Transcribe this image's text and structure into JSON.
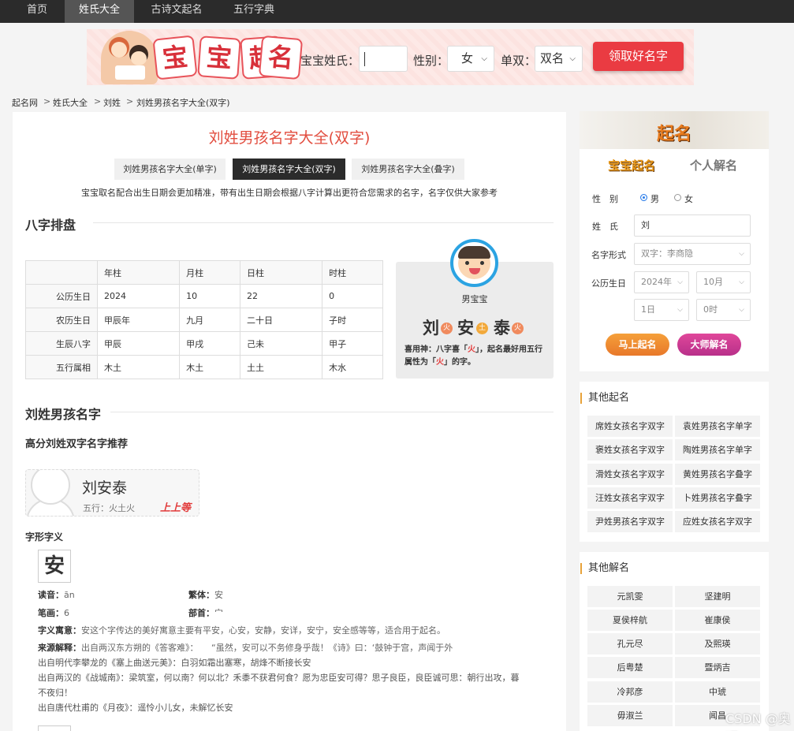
{
  "nav": [
    "首页",
    "姓氏大全",
    "古诗文起名",
    "五行字典"
  ],
  "banner": {
    "title_chars": [
      "宝",
      "宝",
      "起",
      "名"
    ],
    "surname_label": "宝宝姓氏：",
    "gender_label": "性别：",
    "gender_value": "女",
    "single_double_label": "单双：",
    "single_double_value": "双名",
    "button": "领取好名字"
  },
  "breadcrumb": [
    "起名网",
    "姓氏大全",
    "刘姓",
    "刘姓男孩名字大全(双字)"
  ],
  "breadcrumb_sep": ">",
  "page_title": "刘姓男孩名字大全(双字)",
  "tabs": [
    "刘姓男孩名字大全(单字)",
    "刘姓男孩名字大全(双字)",
    "刘姓男孩名字大全(叠字)"
  ],
  "note": "宝宝取名配合出生日期会更加精准，带有出生日期会根据八字计算出更符合您需求的名字，名字仅供大家参考",
  "bazi": {
    "heading": "八字排盘",
    "columns": [
      "年柱",
      "月柱",
      "日柱",
      "时柱"
    ],
    "rows": [
      {
        "label": "公历生日",
        "cells": [
          "2024",
          "10",
          "22",
          "0"
        ]
      },
      {
        "label": "农历生日",
        "cells": [
          "甲辰年",
          "九月",
          "二十日",
          "子时"
        ]
      },
      {
        "label": "生辰八字",
        "cells": [
          "甲辰",
          "甲戌",
          "己未",
          "甲子"
        ]
      },
      {
        "label": "五行属相",
        "cells": [
          "木土",
          "木土",
          "土土",
          "木水"
        ]
      }
    ]
  },
  "baby": {
    "label": "男宝宝",
    "chars": [
      {
        "c": "刘",
        "wx": "火"
      },
      {
        "c": "安",
        "wx": "土"
      },
      {
        "c": "泰",
        "wx": "火"
      }
    ],
    "xiyong_a": "喜用神：八字喜「",
    "xiyong_b": "火",
    "xiyong_c": "」，起名最好用五行属性为「",
    "xiyong_d": "火",
    "xiyong_e": "」的字。"
  },
  "names_heading": "刘姓男孩名字",
  "recommend_heading": "高分刘姓双字名字推荐",
  "name_card": {
    "name": "刘安泰",
    "wuxing": "五行：火土火",
    "grade": "上上等"
  },
  "zixing": {
    "heading": "字形字义",
    "char": "安",
    "duyin_k": "读音：",
    "duyin_v": "ān",
    "fanti_k": "繁体：",
    "fanti_v": "安",
    "bihua_k": "笔画：",
    "bihua_v": "6",
    "bushou_k": "部首：",
    "bushou_v": "宀",
    "yuyi_k": "字义寓意：",
    "yuyi_v": "安这个字传达的美好寓意主要有平安，心安，安静，安详，安宁，安全感等等，适合用于起名。",
    "laiyuan_k": "来源解释：",
    "laiyuan_1": "出自两汉东方朔的《答客难》：　　“虽然，安可以不务修身乎哉！《诗》曰：‘鼓钟于宫，声闻于外",
    "laiyuan_2": "出自明代李攀龙的《塞上曲送元美》：白羽如霜出塞寒，胡烽不断接长安",
    "laiyuan_3": "出自两汉的《战城南》：梁筑室，何以南？何以北？禾黍不获君何食？愿为忠臣安可得？思子良臣，良臣诚可思：朝行出攻，暮",
    "laiyuan_4": "不夜归！",
    "laiyuan_5": "出自唐代杜甫的《月夜》：遥怜小儿女，未解忆长安"
  },
  "sidebar": {
    "logo": "起名",
    "tab1": "宝宝起名",
    "tab2": "个人解名",
    "gender_label": "性　别",
    "male": "男",
    "female": "女",
    "surname_label": "姓　氏",
    "surname_value": "刘",
    "form_label": "名字形式",
    "form_value": "双字：李商隐",
    "date_label": "公历生日",
    "year": "2024年",
    "month": "10月",
    "day": "1日",
    "hour": "0时",
    "btn1": "马上起名",
    "btn2": "大师解名",
    "other_naming_title": "其他起名",
    "other_naming": [
      "席姓女孩名字双字",
      "袁姓男孩名字单字",
      "褒姓女孩名字双字",
      "陶姓男孩名字单字",
      "滑姓女孩名字双字",
      "黄姓男孩名字叠字",
      "汪姓女孩名字双字",
      "卜姓男孩名字叠字",
      "尹姓男孩名字双字",
      "应姓女孩名字双字"
    ],
    "other_jieming_title": "其他解名",
    "other_jieming": [
      "元凯雯",
      "坚建明",
      "夏侯梓航",
      "崔康侯",
      "孔元尽",
      "及熙瑛",
      "后粤楚",
      "暨炳吉",
      "冷邦彦",
      "中琥",
      "毋淑兰",
      "闻昌"
    ]
  },
  "watermark": "CSDN @奥顺",
  "colors": {
    "accent_red": "#e24d3f",
    "nav_bg": "#2b2b2b",
    "orange_btn": "#ef8a2a",
    "purple_btn": "#c63a92"
  }
}
